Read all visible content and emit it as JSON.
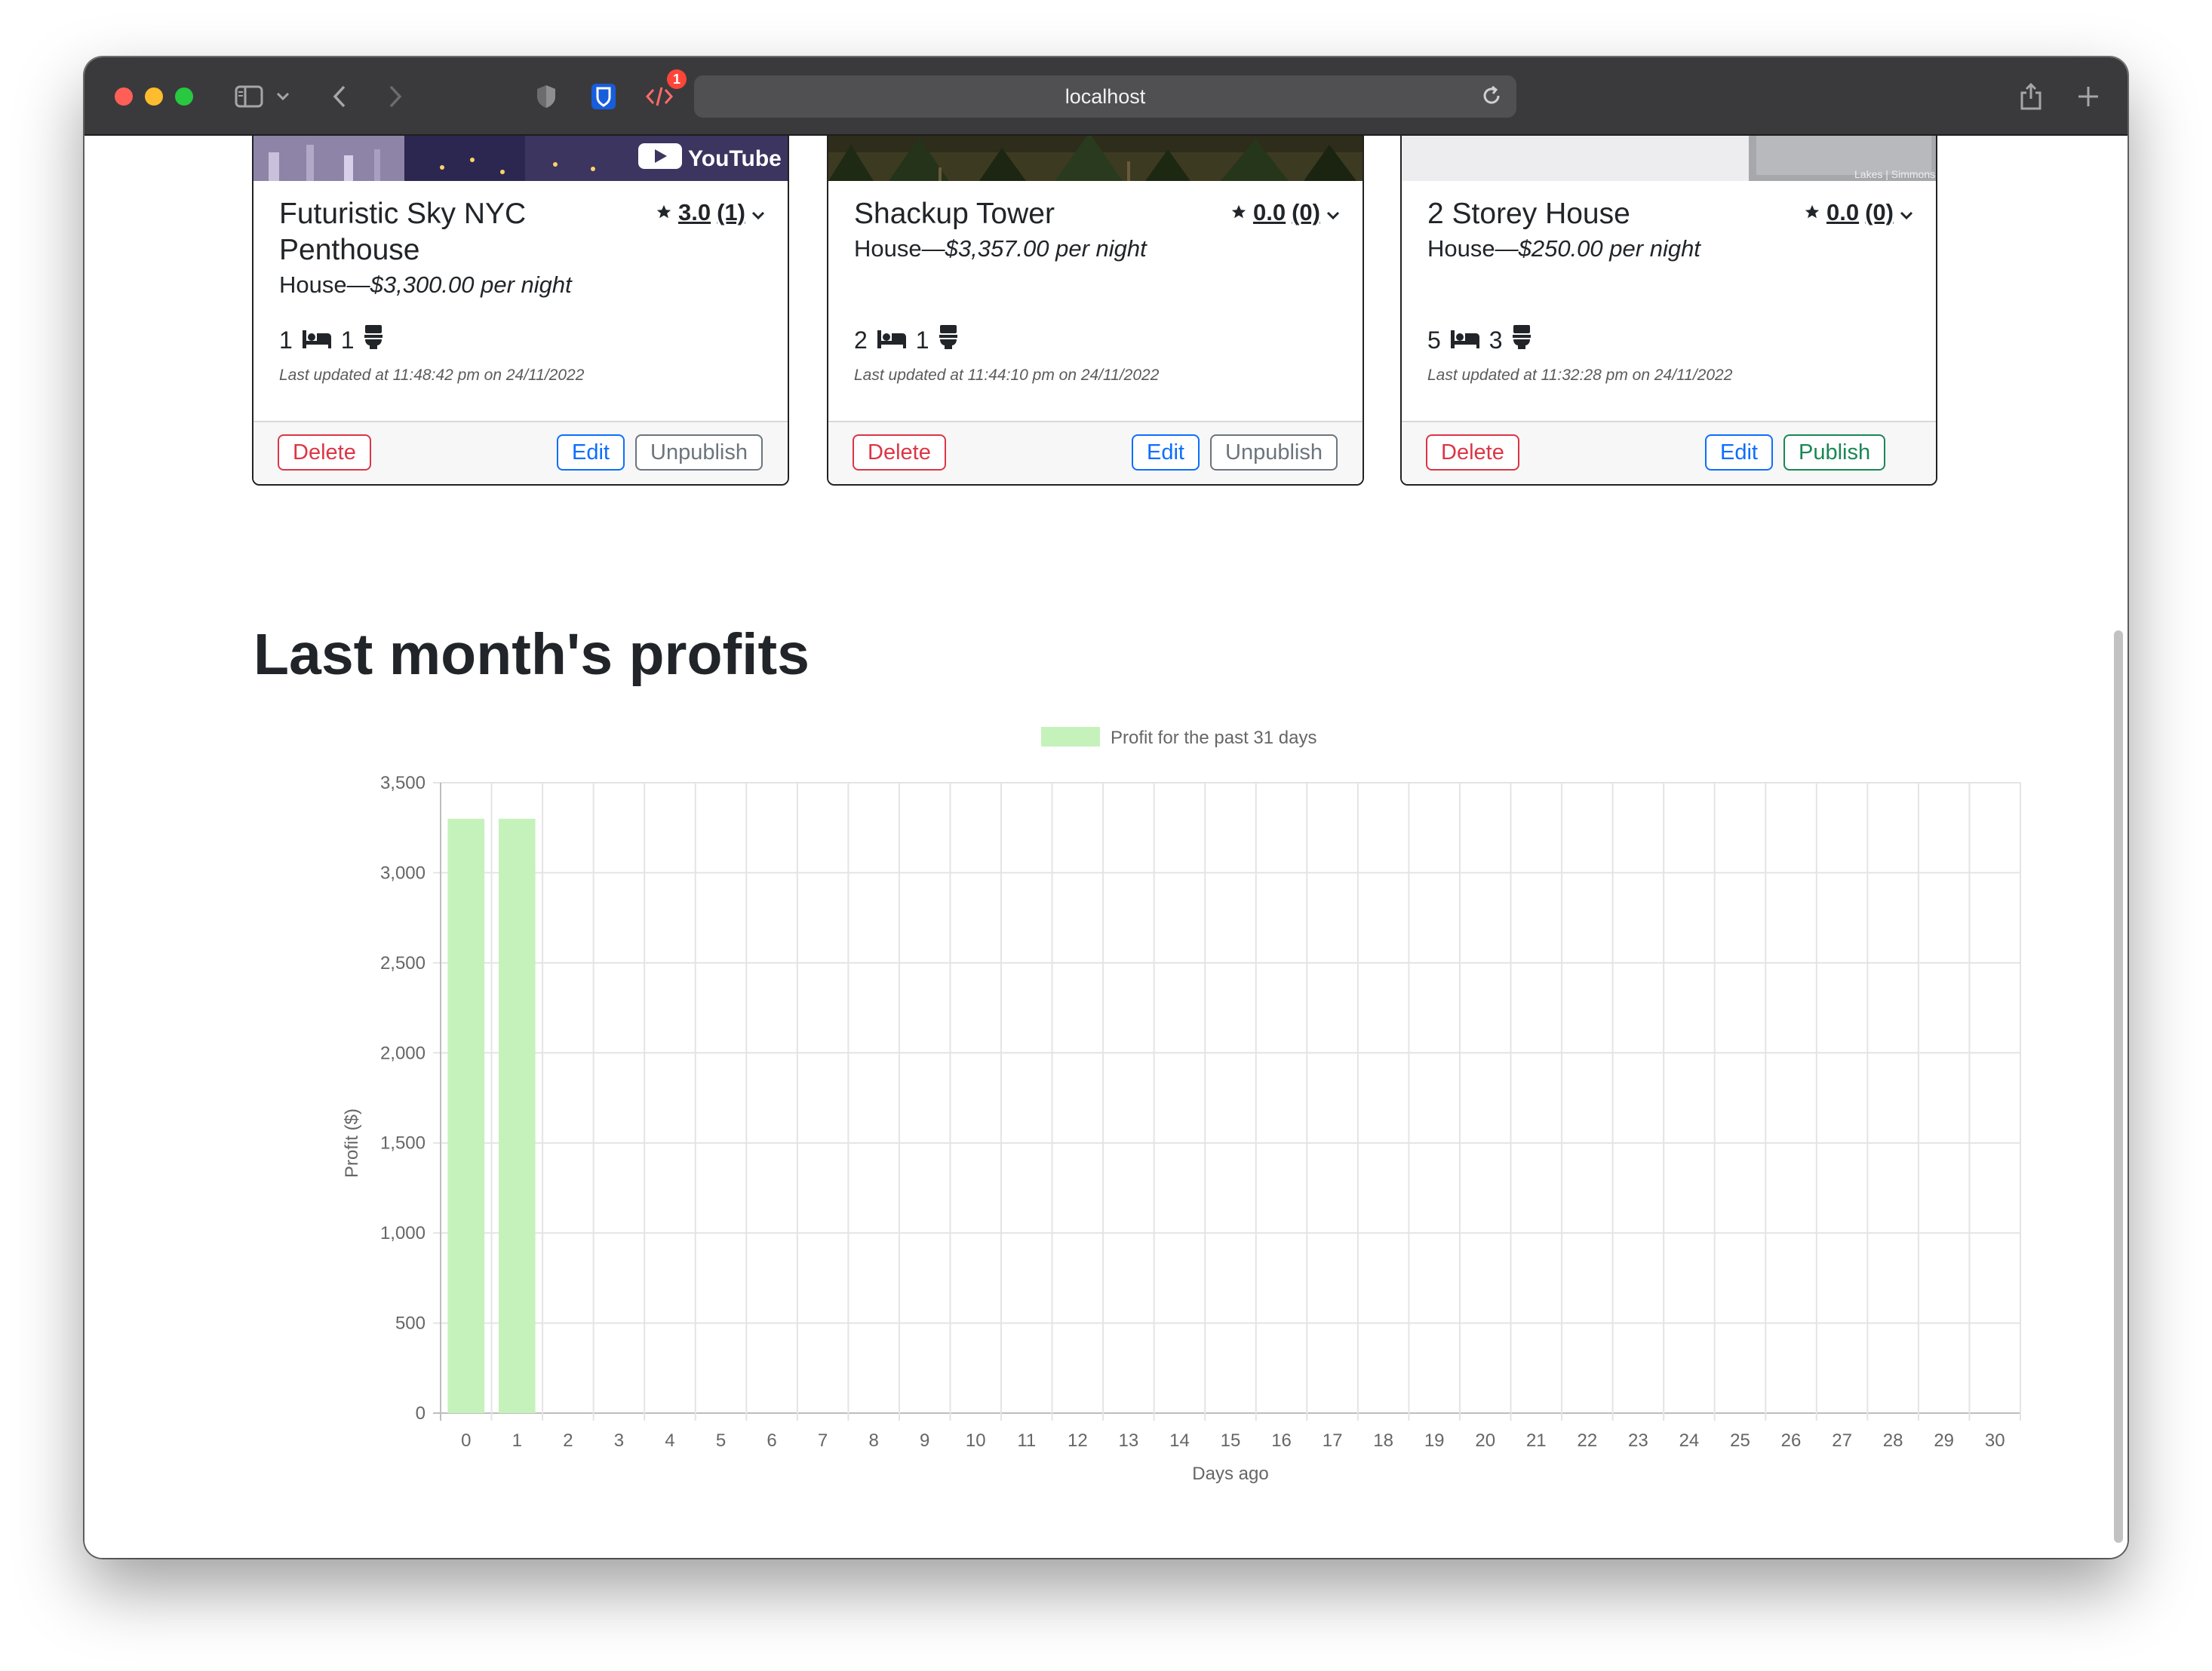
{
  "browser": {
    "url": "localhost",
    "extension_badge": "1"
  },
  "listings": [
    {
      "title": "Futuristic Sky NYC Penthouse",
      "rating": "3.0",
      "reviews": "(1)",
      "type": "House",
      "price": "$3,300.00 per night",
      "beds": "1",
      "bathrooms": "1",
      "updated": "Last updated at 11:48:42 pm on 24/11/2022",
      "delete_label": "Delete",
      "edit_label": "Edit",
      "publish_label": "Unpublish"
    },
    {
      "title": "Shackup Tower",
      "rating": "0.0",
      "reviews": "(0)",
      "type": "House",
      "price": "$3,357.00 per night",
      "beds": "2",
      "bathrooms": "1",
      "updated": "Last updated at 11:44:10 pm on 24/11/2022",
      "delete_label": "Delete",
      "edit_label": "Edit",
      "publish_label": "Unpublish"
    },
    {
      "title": "2 Storey House",
      "rating": "0.0",
      "reviews": "(0)",
      "type": "House",
      "price": "$250.00 per night",
      "beds": "5",
      "bathrooms": "3",
      "updated": "Last updated at 11:32:28 pm on 24/11/2022",
      "delete_label": "Delete",
      "edit_label": "Edit",
      "publish_label": "Publish"
    }
  ],
  "profits_section": {
    "title": "Last month's profits"
  },
  "chart_data": {
    "type": "bar",
    "legend": "Profit for the past 31 days",
    "legend_position": "top",
    "xlabel": "Days ago",
    "ylabel": "Profit ($)",
    "categories": [
      "0",
      "1",
      "2",
      "3",
      "4",
      "5",
      "6",
      "7",
      "8",
      "9",
      "10",
      "11",
      "12",
      "13",
      "14",
      "15",
      "16",
      "17",
      "18",
      "19",
      "20",
      "21",
      "22",
      "23",
      "24",
      "25",
      "26",
      "27",
      "28",
      "29",
      "30"
    ],
    "values": [
      3300,
      3300,
      0,
      0,
      0,
      0,
      0,
      0,
      0,
      0,
      0,
      0,
      0,
      0,
      0,
      0,
      0,
      0,
      0,
      0,
      0,
      0,
      0,
      0,
      0,
      0,
      0,
      0,
      0,
      0,
      0
    ],
    "ylim": [
      0,
      3500
    ],
    "yticks": [
      "0",
      "500",
      "1,000",
      "1,500",
      "2,000",
      "2,500",
      "3,000",
      "3,500"
    ],
    "grid": true,
    "bar_color": "#c5f2bb"
  }
}
